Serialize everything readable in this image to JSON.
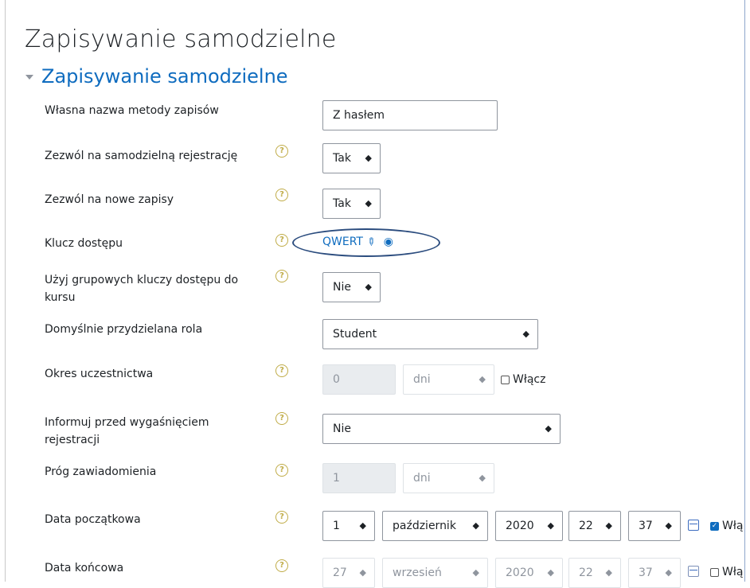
{
  "page": {
    "title": "Zapisywanie samodzielne"
  },
  "section": {
    "title": "Zapisywanie samodzielne"
  },
  "fields": {
    "custom_name": {
      "label": "Własna nazwa metody zapisów",
      "value": "Z hasłem"
    },
    "allow_self": {
      "label": "Zezwól na samodzielną rejestrację",
      "value": "Tak"
    },
    "allow_new": {
      "label": "Zezwól na nowe zapisy",
      "value": "Tak"
    },
    "access_key": {
      "label": "Klucz dostępu",
      "value": "QWERT"
    },
    "group_keys": {
      "label": "Użyj grupowych kluczy dostępu do kursu",
      "value": "Nie"
    },
    "default_role": {
      "label": "Domyślnie przydzielana rola",
      "value": "Student"
    },
    "duration": {
      "label": "Okres uczestnictwa",
      "value": "0",
      "unit": "dni",
      "enable_label": "Włącz",
      "enabled": false
    },
    "notify": {
      "label": "Informuj przed wygaśnięciem rejestracji",
      "value": "Nie"
    },
    "threshold": {
      "label": "Próg zawiadomienia",
      "value": "1",
      "unit": "dni"
    },
    "start_date": {
      "label": "Data początkowa",
      "day": "1",
      "month": "październik",
      "year": "2020",
      "hour": "22",
      "minute": "37",
      "enable_label": "Włą",
      "enabled": true
    },
    "end_date": {
      "label": "Data końcowa",
      "day": "27",
      "month": "wrzesień",
      "year": "2020",
      "hour": "22",
      "minute": "37",
      "enable_label": "Włą",
      "enabled": false
    }
  },
  "icons": {
    "help": "help-question-icon",
    "select_caret": "sort-caret-icon",
    "edit": "pencil-icon",
    "reveal": "eye-icon",
    "calendar": "calendar-icon"
  },
  "colors": {
    "link": "#0f6cbf",
    "help": "#c0ac48",
    "highlight_ellipse": "#2b4c7e"
  }
}
